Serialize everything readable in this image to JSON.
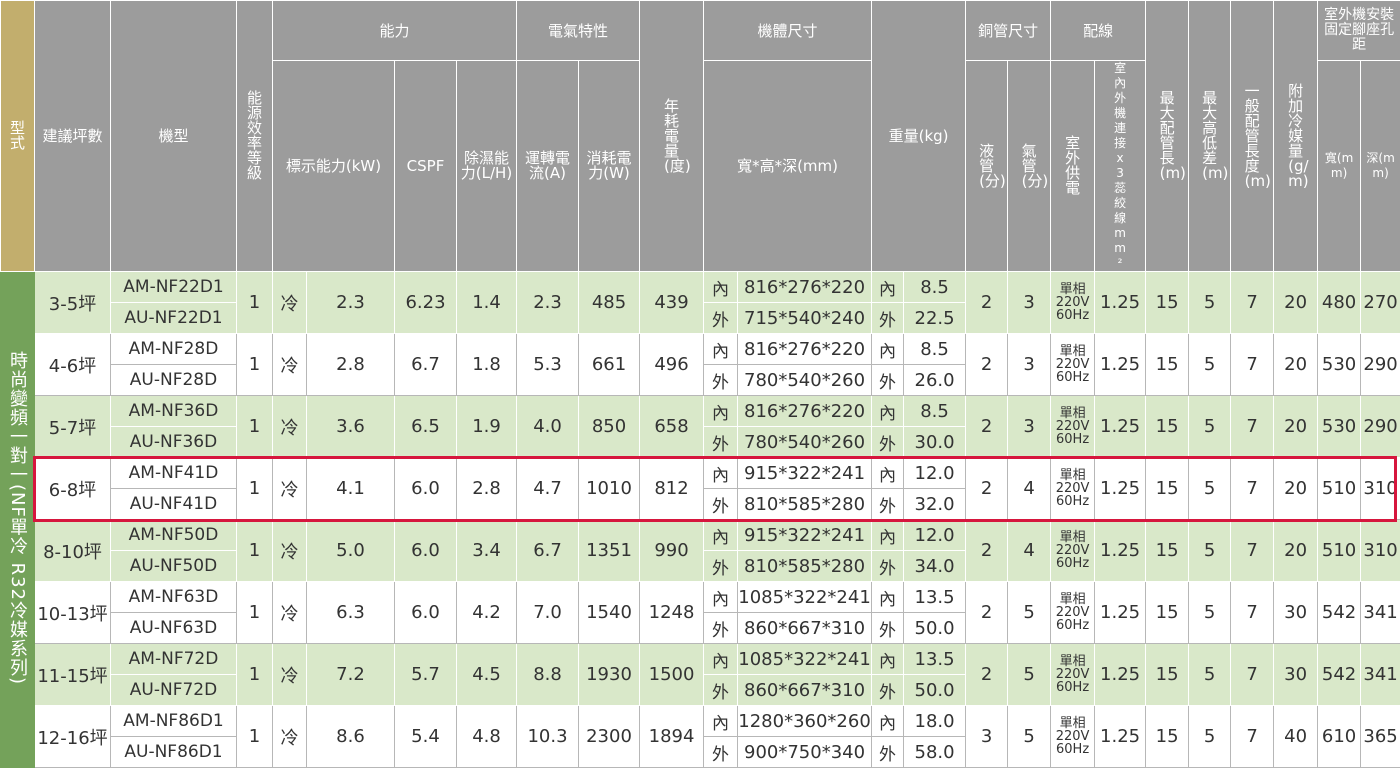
{
  "header": {
    "type": "型式",
    "area": "建議坪數",
    "model": "機型",
    "energy": "能源效率等級",
    "capacity_group": "能力",
    "rated_capacity": "標示能力(kW)",
    "cspf": "CSPF",
    "dehumid": "除濕能力(L/H)",
    "electrical_group": "電氣特性",
    "current": "運轉電流(A)",
    "power": "消耗電力(W)",
    "annual": "年耗電量(度)",
    "dimension_group": "機體尺寸",
    "dimension": "寬*高*深(mm)",
    "weight": "重量(kg)",
    "pipe_group": "銅管尺寸",
    "liquid": "液管(分)",
    "gas": "氣管(分)",
    "wiring_group": "配線",
    "outdoor_power": "室外供電",
    "connect_wire": "室內外機連接x3蕊絞線mm²",
    "max_pipe": "最大配管長(m)",
    "max_height": "最大高低差(m)",
    "normal_pipe": "一般配管長度(m)",
    "extra_refrigerant": "附加冷媒量(g/m)",
    "mount_group": "室外機安裝固定腳座孔距",
    "mount_w": "寬(mm)",
    "mount_d": "深(mm)"
  },
  "series_label": "時尚變頻一對一(NF單冷 R32冷媒系列)",
  "labels": {
    "indoor": "內",
    "outdoor": "外",
    "cool": "冷",
    "power_supply": "單相220V 60Hz"
  },
  "rows": [
    {
      "area": "3-5坪",
      "indoor_model": "AM-NF22D1",
      "outdoor_model": "AU-NF22D1",
      "grade": "1",
      "capacity": "2.3",
      "cspf": "6.23",
      "dehumid": "1.4",
      "current": "2.3",
      "power": "485",
      "annual": "439",
      "dim_in": "816*276*220",
      "dim_out": "715*540*240",
      "w_in": "8.5",
      "w_out": "22.5",
      "liquid": "2",
      "gas": "3",
      "wire": "1.25",
      "max_pipe": "15",
      "max_height": "5",
      "normal_pipe": "7",
      "extra": "20",
      "mount_w": "480",
      "mount_d": "270"
    },
    {
      "area": "4-6坪",
      "indoor_model": "AM-NF28D",
      "outdoor_model": "AU-NF28D",
      "grade": "1",
      "capacity": "2.8",
      "cspf": "6.7",
      "dehumid": "1.8",
      "current": "5.3",
      "power": "661",
      "annual": "496",
      "dim_in": "816*276*220",
      "dim_out": "780*540*260",
      "w_in": "8.5",
      "w_out": "26.0",
      "liquid": "2",
      "gas": "3",
      "wire": "1.25",
      "max_pipe": "15",
      "max_height": "5",
      "normal_pipe": "7",
      "extra": "20",
      "mount_w": "530",
      "mount_d": "290"
    },
    {
      "area": "5-7坪",
      "indoor_model": "AM-NF36D",
      "outdoor_model": "AU-NF36D",
      "grade": "1",
      "capacity": "3.6",
      "cspf": "6.5",
      "dehumid": "1.9",
      "current": "4.0",
      "power": "850",
      "annual": "658",
      "dim_in": "816*276*220",
      "dim_out": "780*540*260",
      "w_in": "8.5",
      "w_out": "30.0",
      "liquid": "2",
      "gas": "3",
      "wire": "1.25",
      "max_pipe": "15",
      "max_height": "5",
      "normal_pipe": "7",
      "extra": "20",
      "mount_w": "530",
      "mount_d": "290"
    },
    {
      "area": "6-8坪",
      "indoor_model": "AM-NF41D",
      "outdoor_model": "AU-NF41D",
      "grade": "1",
      "capacity": "4.1",
      "cspf": "6.0",
      "dehumid": "2.8",
      "current": "4.7",
      "power": "1010",
      "annual": "812",
      "dim_in": "915*322*241",
      "dim_out": "810*585*280",
      "w_in": "12.0",
      "w_out": "32.0",
      "liquid": "2",
      "gas": "4",
      "wire": "1.25",
      "max_pipe": "15",
      "max_height": "5",
      "normal_pipe": "7",
      "extra": "20",
      "mount_w": "510",
      "mount_d": "310"
    },
    {
      "area": "8-10坪",
      "indoor_model": "AM-NF50D",
      "outdoor_model": "AU-NF50D",
      "grade": "1",
      "capacity": "5.0",
      "cspf": "6.0",
      "dehumid": "3.4",
      "current": "6.7",
      "power": "1351",
      "annual": "990",
      "dim_in": "915*322*241",
      "dim_out": "810*585*280",
      "w_in": "12.0",
      "w_out": "34.0",
      "liquid": "2",
      "gas": "4",
      "wire": "1.25",
      "max_pipe": "15",
      "max_height": "5",
      "normal_pipe": "7",
      "extra": "20",
      "mount_w": "510",
      "mount_d": "310"
    },
    {
      "area": "10-13坪",
      "indoor_model": "AM-NF63D",
      "outdoor_model": "AU-NF63D",
      "grade": "1",
      "capacity": "6.3",
      "cspf": "6.0",
      "dehumid": "4.2",
      "current": "7.0",
      "power": "1540",
      "annual": "1248",
      "dim_in": "1085*322*241",
      "dim_out": "860*667*310",
      "w_in": "13.5",
      "w_out": "50.0",
      "liquid": "2",
      "gas": "5",
      "wire": "1.25",
      "max_pipe": "15",
      "max_height": "5",
      "normal_pipe": "7",
      "extra": "30",
      "mount_w": "542",
      "mount_d": "341"
    },
    {
      "area": "11-15坪",
      "indoor_model": "AM-NF72D",
      "outdoor_model": "AU-NF72D",
      "grade": "1",
      "capacity": "7.2",
      "cspf": "5.7",
      "dehumid": "4.5",
      "current": "8.8",
      "power": "1930",
      "annual": "1500",
      "dim_in": "1085*322*241",
      "dim_out": "860*667*310",
      "w_in": "13.5",
      "w_out": "50.0",
      "liquid": "2",
      "gas": "5",
      "wire": "1.25",
      "max_pipe": "15",
      "max_height": "5",
      "normal_pipe": "7",
      "extra": "30",
      "mount_w": "542",
      "mount_d": "341"
    },
    {
      "area": "12-16坪",
      "indoor_model": "AM-NF86D1",
      "outdoor_model": "AU-NF86D1",
      "grade": "1",
      "capacity": "8.6",
      "cspf": "5.4",
      "dehumid": "4.8",
      "current": "10.3",
      "power": "2300",
      "annual": "1894",
      "dim_in": "1280*360*260",
      "dim_out": "900*750*340",
      "w_in": "18.0",
      "w_out": "58.0",
      "liquid": "3",
      "gas": "5",
      "wire": "1.25",
      "max_pipe": "15",
      "max_height": "5",
      "normal_pipe": "7",
      "extra": "40",
      "mount_w": "610",
      "mount_d": "365"
    }
  ],
  "highlight_row": 3,
  "colors": {
    "header": "#9c9c9c",
    "type_header": "#c2ae6d",
    "series": "#74a25a",
    "green_row": "#d9e8c9",
    "highlight": "#d6163d"
  }
}
